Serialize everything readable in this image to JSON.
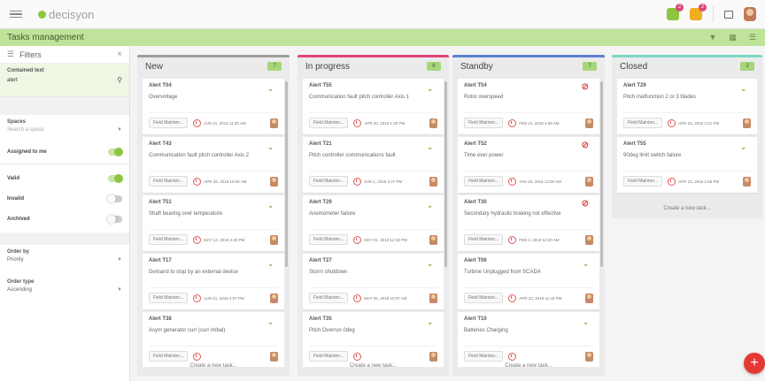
{
  "app": {
    "logo_text": "decisyon"
  },
  "header": {
    "badges": [
      "2",
      "2"
    ]
  },
  "titlebar": {
    "title": "Tasks management"
  },
  "sidebar": {
    "filters_label": "Filters",
    "close": "×",
    "contained_text_label": "Contained text",
    "contained_text_value": "alert",
    "spaces_label": "Spaces",
    "spaces_placeholder": "Search a space",
    "assigned_to_me": "Assigned to me",
    "valid": "Valid",
    "invalid": "Invalid",
    "archived": "Archived",
    "order_by_label": "Order by",
    "order_by_value": "Priority",
    "order_type_label": "Order type",
    "order_type_value": "Ascending"
  },
  "create_label": "Create a new task...",
  "columns": [
    {
      "title": "New",
      "count": "7",
      "color": "#9e9e9e",
      "cards": [
        {
          "id": "Alert T04",
          "desc": "Overvoltage",
          "status": "green",
          "tag": "Field Mainten...",
          "date": "JUN 21, 2018 11:30 AM"
        },
        {
          "id": "Alert T43",
          "desc": "Communication fault pitch controller Axis 2",
          "status": "green",
          "tag": "Field Mainten...",
          "date": "APR 25, 2018 10:56 AM"
        },
        {
          "id": "Alert T51",
          "desc": "Shaft bearing over temperature",
          "status": "green",
          "tag": "Field Mainten...",
          "date": "MAY 14, 2018 4:30 PM"
        },
        {
          "id": "Alert T17",
          "desc": "Demand to stop by an external device",
          "status": "green",
          "tag": "Field Mainten...",
          "date": "JUN 21, 2018 4:07 PM"
        },
        {
          "id": "Alert T38",
          "desc": "Asym generator curr (curr imbal)",
          "status": "green",
          "tag": "Field Mainten...",
          "date": ""
        }
      ]
    },
    {
      "title": "In progress",
      "count": "6",
      "color": "#e0457b",
      "cards": [
        {
          "id": "Alert T55",
          "desc": "Communication fault pitch controller Axis 1",
          "status": "green",
          "tag": "Field Mainten...",
          "date": "APR 20, 2018 1:20 PM"
        },
        {
          "id": "Alert T21",
          "desc": "Pitch controller communications fault",
          "status": "green",
          "tag": "Field Mainten...",
          "date": "JUN 1, 2018 3:47 PM"
        },
        {
          "id": "Alert T29",
          "desc": "Anemometer failure",
          "status": "green",
          "tag": "Field Mainten...",
          "date": "MAY 01, 2018 12:18 PM"
        },
        {
          "id": "Alert T27",
          "desc": "Storm shutdown",
          "status": "green",
          "tag": "Field Mainten...",
          "date": "MAY 06, 2018 10:07 AM"
        },
        {
          "id": "Alert T35",
          "desc": "Pitch Overrun 0deg",
          "status": "green",
          "tag": "Field Mainten...",
          "date": ""
        }
      ]
    },
    {
      "title": "Standby",
      "count": "7",
      "color": "#5c7fd1",
      "cards": [
        {
          "id": "Alert T54",
          "desc": "Rotor overspeed",
          "status": "red",
          "tag": "Field Mainten...",
          "date": "FEB 14, 2018 4:38 AM"
        },
        {
          "id": "Alert T52",
          "desc": "Time over power",
          "status": "red",
          "tag": "Field Mainten...",
          "date": "JAN 19, 2018 12:00 AM"
        },
        {
          "id": "Alert T30",
          "desc": "Secondary hydraulic braking not effective",
          "status": "red",
          "tag": "Field Mainten...",
          "date": "FEB 2, 2018 12:00 AM"
        },
        {
          "id": "Alert T06",
          "desc": "Turbine Unplugged from SCADA",
          "status": "green",
          "tag": "Field Mainten...",
          "date": "APR 23, 2018 11:40 PM"
        },
        {
          "id": "Alert T10",
          "desc": "Batteries Charging",
          "status": "green",
          "tag": "Field Mainten...",
          "date": ""
        }
      ]
    },
    {
      "title": "Closed",
      "count": "2",
      "color": "#7fd8c6",
      "cards": [
        {
          "id": "Alert T29",
          "desc": "Pitch malfunction 2 or 3 blades",
          "status": "green",
          "tag": "Field Mainten...",
          "date": "APR 24, 2018 1:01 PM"
        },
        {
          "id": "Alert T55",
          "desc": "90deg limit switch failure",
          "status": "green",
          "tag": "Field Mainten...",
          "date": "APR 23, 2018 1:56 PM"
        }
      ]
    }
  ],
  "fab_label": "+"
}
